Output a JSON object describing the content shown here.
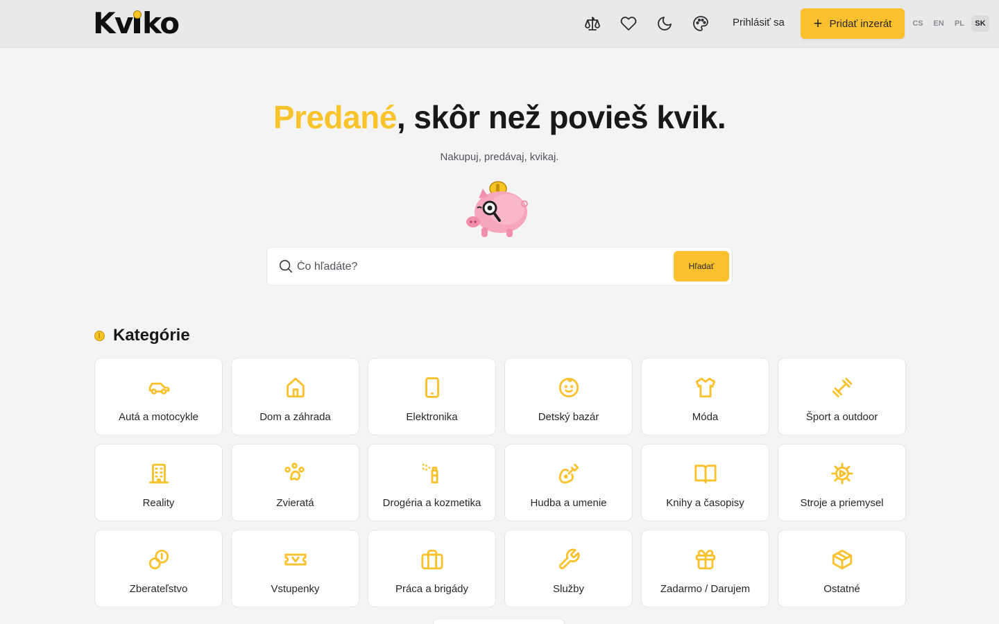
{
  "header": {
    "logo": "Kviko",
    "icons": [
      "scale-icon",
      "heart-icon",
      "moon-icon",
      "palette-icon"
    ],
    "login_label": "Prihlásiť sa",
    "add_label": "Pridať inzerát",
    "languages": [
      "CS",
      "EN",
      "PL",
      "SK"
    ],
    "active_language": "SK"
  },
  "hero": {
    "title_accent": "Predané",
    "title_rest": ", skôr než povieš kvik.",
    "tagline": "Nakupuj, predávaj, kvikaj."
  },
  "search": {
    "placeholder": "Čo hľadáte?",
    "button_label": "Hľadať"
  },
  "categories": {
    "title": "Kategórie",
    "items": [
      {
        "label": "Autá a motocykle",
        "icon": "car-icon"
      },
      {
        "label": "Dom a záhrada",
        "icon": "house-icon"
      },
      {
        "label": "Elektronika",
        "icon": "phone-icon"
      },
      {
        "label": "Detský bazár",
        "icon": "baby-icon"
      },
      {
        "label": "Móda",
        "icon": "shirt-icon"
      },
      {
        "label": "Šport a outdoor",
        "icon": "dumbbell-icon"
      },
      {
        "label": "Reality",
        "icon": "building-icon"
      },
      {
        "label": "Zvieratá",
        "icon": "paw-icon"
      },
      {
        "label": "Drogéria a kozmetika",
        "icon": "spray-bottle-icon"
      },
      {
        "label": "Hudba a umenie",
        "icon": "guitar-icon"
      },
      {
        "label": "Knihy a časopisy",
        "icon": "book-icon"
      },
      {
        "label": "Stroje a priemysel",
        "icon": "gear-icon"
      },
      {
        "label": "Zberateľstvo",
        "icon": "coins-icon"
      },
      {
        "label": "Vstupenky",
        "icon": "ticket-icon"
      },
      {
        "label": "Práca a brigády",
        "icon": "briefcase-icon"
      },
      {
        "label": "Služby",
        "icon": "wrench-icon"
      },
      {
        "label": "Zadarmo / Darujem",
        "icon": "gift-icon"
      },
      {
        "label": "Ostatné",
        "icon": "box-icon"
      }
    ]
  },
  "colors": {
    "accent": "#fbc02d",
    "icon": "#f9c12b",
    "background": "#f4f4f5",
    "text": "#18181b"
  }
}
